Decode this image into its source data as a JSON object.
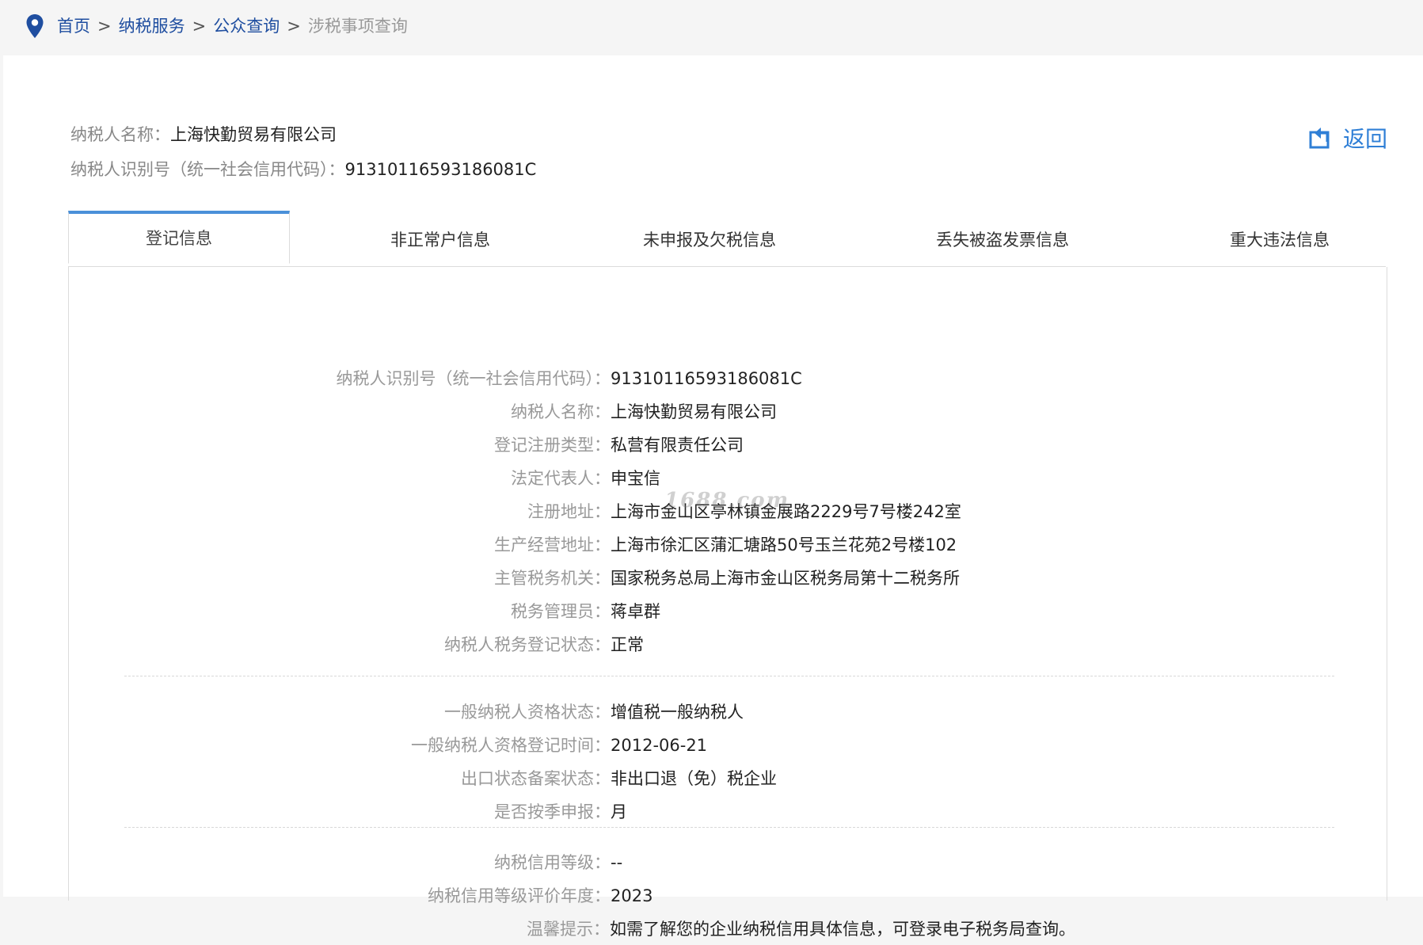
{
  "breadcrumb": {
    "items": [
      "首页",
      "纳税服务",
      "公众查询"
    ],
    "separator": ">",
    "current": "涉税事项查询"
  },
  "header": {
    "name_label": "纳税人名称：",
    "name_value": "上海快勤贸易有限公司",
    "id_label": "纳税人识别号（统一社会信用代码）：",
    "id_value": "91310116593186081C",
    "back_label": "返回"
  },
  "tabs": [
    {
      "label": "登记信息",
      "active": true
    },
    {
      "label": "非正常户信息",
      "active": false
    },
    {
      "label": "未申报及欠税信息",
      "active": false
    },
    {
      "label": "丢失被盗发票信息",
      "active": false
    },
    {
      "label": "重大违法信息",
      "active": false
    }
  ],
  "registration": {
    "group1": [
      {
        "label": "纳税人识别号（统一社会信用代码）：",
        "value": "91310116593186081C"
      },
      {
        "label": "纳税人名称：",
        "value": "上海快勤贸易有限公司"
      },
      {
        "label": "登记注册类型：",
        "value": "私营有限责任公司"
      },
      {
        "label": "法定代表人：",
        "value": "申宝信"
      },
      {
        "label": "注册地址：",
        "value": "上海市金山区亭林镇金展路2229号7号楼242室"
      },
      {
        "label": "生产经营地址：",
        "value": "上海市徐汇区蒲汇塘路50号玉兰花苑2号楼102"
      },
      {
        "label": "主管税务机关：",
        "value": "国家税务总局上海市金山区税务局第十二税务所"
      },
      {
        "label": "税务管理员：",
        "value": "蒋卓群"
      },
      {
        "label": "纳税人税务登记状态：",
        "value": "正常"
      }
    ],
    "group2": [
      {
        "label": "一般纳税人资格状态：",
        "value": "增值税一般纳税人"
      },
      {
        "label": "一般纳税人资格登记时间：",
        "value": "2012-06-21"
      },
      {
        "label": "出口状态备案状态：",
        "value": "非出口退（免）税企业"
      },
      {
        "label": "是否按季申报：",
        "value": "月"
      }
    ],
    "group3": [
      {
        "label": "纳税信用等级：",
        "value": "--"
      },
      {
        "label": "纳税信用等级评价年度：",
        "value": "2023"
      },
      {
        "label": "温馨提示：",
        "value": "如需了解您的企业纳税信用具体信息，可登录电子税务局查询。"
      }
    ]
  },
  "watermark": "1688.com",
  "colors": {
    "link": "#1f4ea0",
    "accent": "#2f7fd6",
    "tab_active_border": "#4a90d9",
    "label": "#999999"
  }
}
